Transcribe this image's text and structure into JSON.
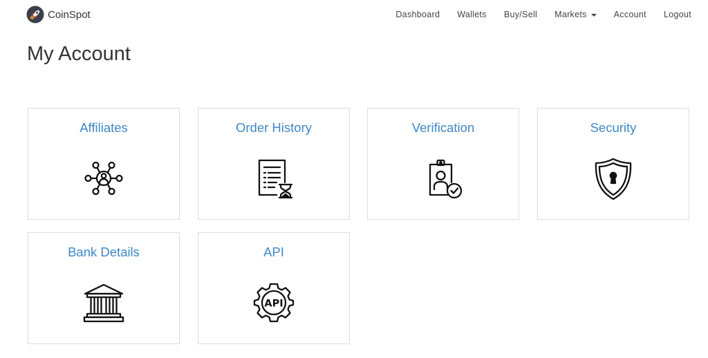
{
  "brand": {
    "name": "CoinSpot",
    "logo_icon": "rocket-logo-icon"
  },
  "nav": {
    "items": [
      {
        "label": "Dashboard"
      },
      {
        "label": "Wallets"
      },
      {
        "label": "Buy/Sell"
      },
      {
        "label": "Markets",
        "has_dropdown": true
      },
      {
        "label": "Account"
      },
      {
        "label": "Logout"
      }
    ]
  },
  "page": {
    "title": "My Account"
  },
  "cards": [
    {
      "title": "Affiliates",
      "icon": "affiliate-network-icon"
    },
    {
      "title": "Order History",
      "icon": "order-history-icon"
    },
    {
      "title": "Verification",
      "icon": "verification-badge-icon"
    },
    {
      "title": "Security",
      "icon": "shield-keyhole-icon"
    },
    {
      "title": "Bank Details",
      "icon": "bank-building-icon"
    },
    {
      "title": "API",
      "icon": "api-gear-icon"
    }
  ],
  "colors": {
    "card_title": "#3f88c5",
    "card_border": "#dcdcdc",
    "nav_text": "#444444",
    "heading_text": "#333333",
    "icon_stroke": "#111111"
  }
}
